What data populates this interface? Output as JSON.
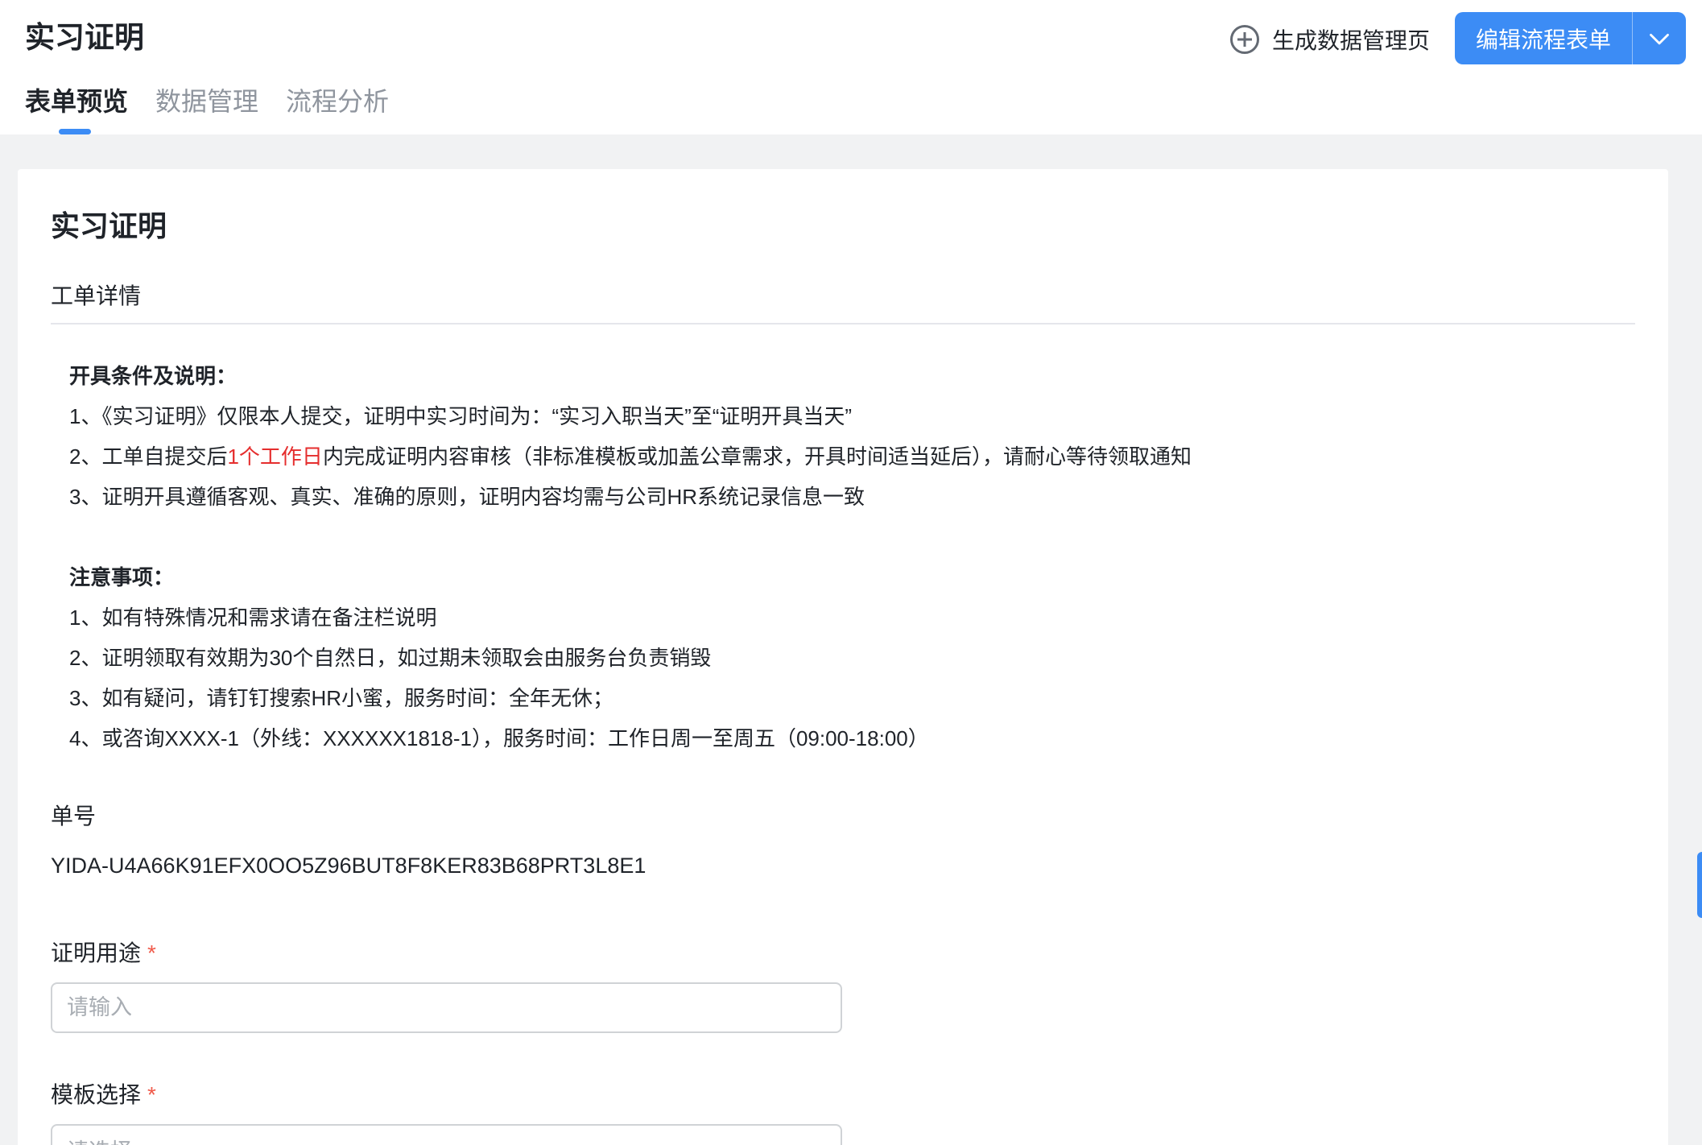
{
  "header": {
    "title": "实习证明",
    "gen_page_label": "生成数据管理页",
    "edit_button_label": "编辑流程表单"
  },
  "tabs": [
    {
      "label": "表单预览",
      "active": true
    },
    {
      "label": "数据管理",
      "active": false
    },
    {
      "label": "流程分析",
      "active": false
    }
  ],
  "form": {
    "title": "实习证明",
    "section_title": "工单详情",
    "conditions": {
      "heading": "开具条件及说明：",
      "item1": "1、《实习证明》仅限本人提交，证明中实习时间为：“实习入职当天”至“证明开具当天”",
      "item2_prefix": "2、工单自提交后",
      "item2_highlight": "1个工作日",
      "item2_suffix": "内完成证明内容审核（非标准模板或加盖公章需求，开具时间适当延后），请耐心等待领取通知",
      "item3": "3、证明开具遵循客观、真实、准确的原则，证明内容均需与公司HR系统记录信息一致"
    },
    "notes": {
      "heading": "注意事项：",
      "items": [
        "1、如有特殊情况和需求请在备注栏说明",
        "2、证明领取有效期为30个自然日，如过期未领取会由服务台负责销毁",
        "3、如有疑问，请钉钉搜索HR小蜜，服务时间：全年无休；",
        "4、或咨询XXXX-1（外线：XXXXXX1818-1），服务时间：工作日周一至周五（09:00-18:00）"
      ]
    },
    "order_no_label": "单号",
    "order_no_value": "YIDA-U4A66K91EFX0OO5Z96BUT8F8KER83B68PRT3L8E1",
    "purpose_label": "证明用途",
    "purpose_placeholder": "请输入",
    "template_label": "模板选择",
    "template_placeholder": "请选择",
    "required_mark": "*"
  },
  "colors": {
    "primary": "#3c8cf5",
    "highlight_red": "#e52e2e",
    "required_red": "#f05a4a"
  }
}
